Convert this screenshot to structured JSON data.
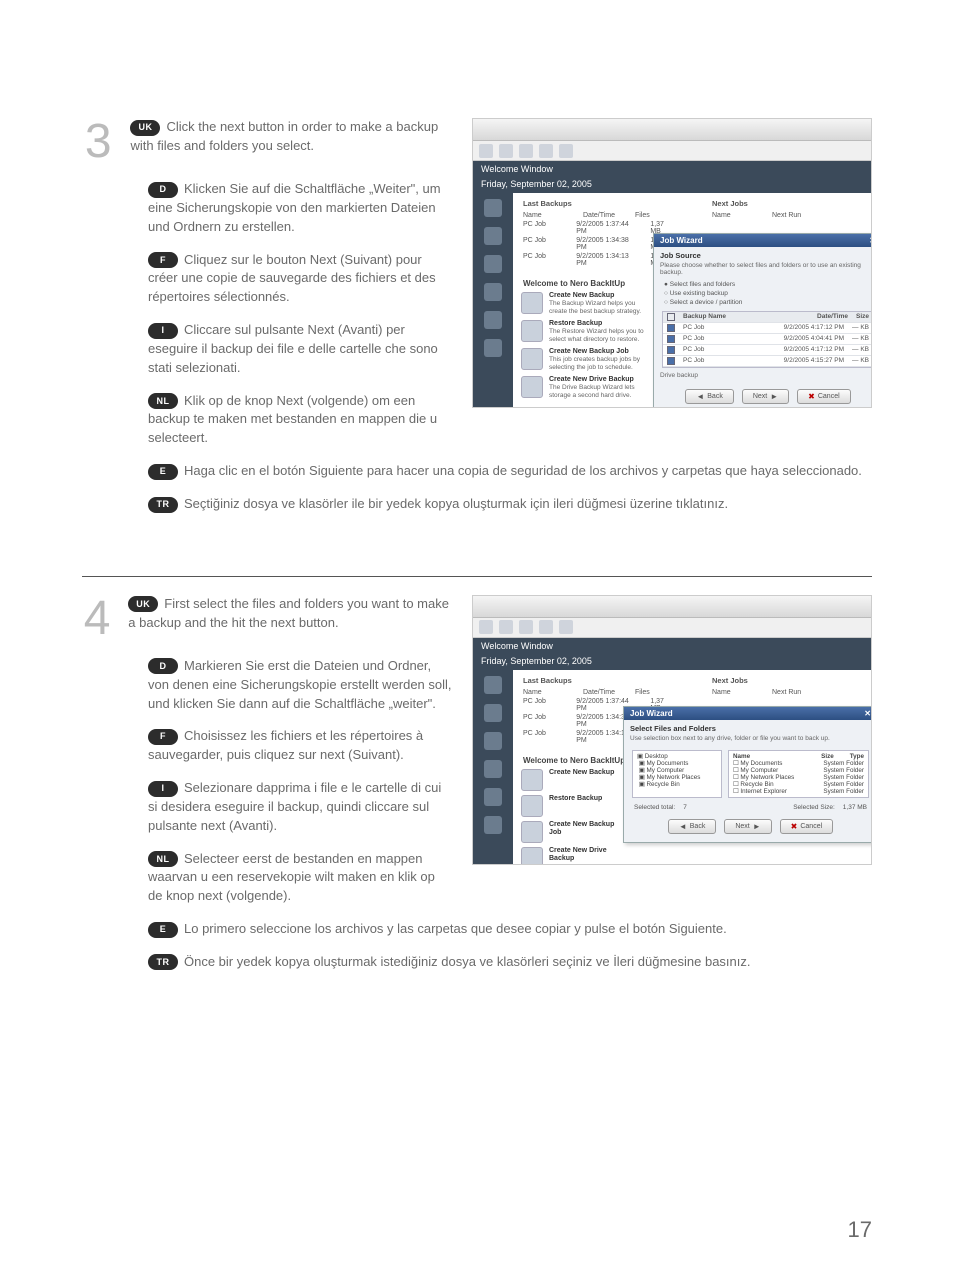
{
  "page_number": "17",
  "sections": [
    {
      "step": "3",
      "langs": {
        "UK": "Click the next button in order to make a backup with files and folders you select.",
        "D": "Klicken Sie auf die Schaltfläche „Weiter\", um eine Sicherungskopie von den markierten Dateien und Ordnern zu erstellen.",
        "F": "Cliquez sur le bouton Next (Suivant) pour créer une copie de sauvegarde des fichiers et des répertoires sélectionnés.",
        "I": "Cliccare sul pulsante Next (Avanti) per eseguire il backup dei file e delle cartelle che sono stati selezionati.",
        "NL": "Klik op de knop Next (volgende) om een backup te maken met bestanden en mappen die u selecteert.",
        "E": "Haga clic en el botón Siguiente para hacer una copia de seguridad de los archivos y carpetas que haya seleccionado.",
        "TR": "Seçtiğiniz dosya ve klasörler ile bir yedek kopya oluşturmak için ileri düğmesi üzerine tıklatınız."
      }
    },
    {
      "step": "4",
      "langs": {
        "UK": "First select the files and folders you want to make a backup and the hit the next button.",
        "D": "Markieren Sie erst die Dateien und Ordner, von denen eine Sicherungskopie erstellt werden soll, und klicken Sie dann auf die Schaltfläche „weiter\".",
        "F": "Choisissez les fichiers et les répertoires à sauvegarder, puis cliquez sur next (Suivant).",
        "I": "Selezionare dapprima i file e le cartelle di cui si desidera eseguire il backup, quindi cliccare sul pulsante next (Avanti).",
        "NL": "Selecteer eerst de bestanden en mappen waarvan u een reservekopie wilt maken en klik op de knop next (volgende).",
        "E": "Lo primero seleccione los archivos y las carpetas que desee copiar y pulse el botón Siguiente.",
        "TR": "Önce bir yedek kopya oluşturmak istediğiniz dosya ve klasörleri seçiniz ve İleri düğmesine basınız."
      }
    }
  ],
  "badges": {
    "UK": "UK",
    "D": "D",
    "F": "F",
    "I": "I",
    "NL": "NL",
    "E": "E",
    "TR": "TR"
  },
  "screenshots": {
    "common": {
      "welcome_window": "Welcome Window",
      "date": "Friday, September 02, 2005",
      "last_backups": "Last Backups",
      "next_jobs": "Next Jobs",
      "col_name": "Name",
      "col_datetime": "Date/Time",
      "col_files": "Files",
      "col_next_run": "Next Run",
      "rows": [
        {
          "name": "PC Job",
          "dt": "9/2/2005 1:37:44 PM",
          "files": "1,37 MB"
        },
        {
          "name": "PC Job",
          "dt": "9/2/2005 1:34:38 PM",
          "files": "1,37 MB"
        },
        {
          "name": "PC Job",
          "dt": "9/2/2005 1:34:13 PM",
          "files": "1,37 MB"
        }
      ],
      "welcome_hdr": "Welcome to Nero BackItUp",
      "cards": [
        {
          "t": "Create New Backup",
          "d": "The Backup Wizard helps you create the best backup strategy."
        },
        {
          "t": "Restore Backup",
          "d": "The Restore Wizard helps you to select what directory to restore."
        },
        {
          "t": "Create New Backup Job",
          "d": "This job creates backup jobs by selecting the job to schedule."
        },
        {
          "t": "Create New Drive Backup",
          "d": "The Drive Backup Wizard lets storage a second hard drive."
        }
      ],
      "btn_back": "Back",
      "btn_next": "Next",
      "btn_cancel": "Cancel"
    },
    "step3": {
      "dialog_title": "Job Wizard",
      "section": "Job Source",
      "desc": "Please choose whether to select files and folders or to use an existing backup.",
      "opts": [
        "Select files and folders",
        "Use existing backup",
        "Select a device / partition"
      ],
      "tbl_hdr": {
        "name": "Backup Name",
        "dt": "Date/Time",
        "sz": "Size"
      },
      "tbl_rows": [
        {
          "n": "PC Job",
          "dt": "9/2/2005 4:17:12 PM",
          "sz": "— KB"
        },
        {
          "n": "PC Job",
          "dt": "9/2/2005 4:04:41 PM",
          "sz": "— KB"
        },
        {
          "n": "PC Job",
          "dt": "9/2/2005 4:17:12 PM",
          "sz": "— KB"
        },
        {
          "n": "PC Job",
          "dt": "9/2/2005 4:15:27 PM",
          "sz": "— KB"
        }
      ],
      "drive_label": "Drive backup"
    },
    "step4": {
      "dialog_title": "Job Wizard",
      "section": "Select Files and Folders",
      "desc": "Use selection box next to any drive, folder or file you want to back up.",
      "tree_left": [
        "Desktop",
        "My Documents",
        "My Computer",
        "My Network Places",
        "Recycle Bin"
      ],
      "tree_right": [
        "My Documents",
        "My Computer",
        "My Network Places",
        "Recycle Bin",
        "Internet Explorer"
      ],
      "tree_cols": {
        "name": "Name",
        "size": "Size",
        "type": "Type"
      },
      "type_vals": [
        "System Folder",
        "System Folder",
        "System Folder",
        "System Folder",
        "System Folder"
      ],
      "sel_total": "Selected total:",
      "sel_size_label": "Selected Size:",
      "sel_size_val": "1,37 MB",
      "sel_count": "7"
    }
  }
}
